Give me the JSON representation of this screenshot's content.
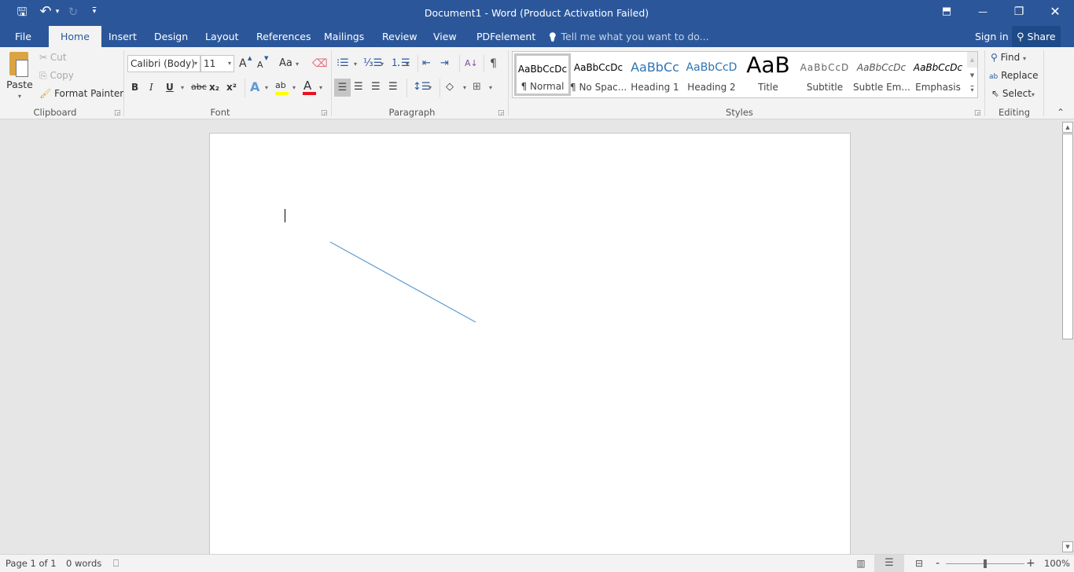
{
  "window": {
    "title": "Document1 - Word (Product Activation Failed)",
    "controls": {
      "ribbon_display": "⬒",
      "minimize": "—",
      "restore": "❐",
      "close": "✕"
    }
  },
  "quick_access": {
    "save": "🖫",
    "undo": "↶",
    "undo_dd": "▾",
    "redo": "↻",
    "customize": "▾"
  },
  "tabs": [
    {
      "label": "File"
    },
    {
      "label": "Home"
    },
    {
      "label": "Insert"
    },
    {
      "label": "Design"
    },
    {
      "label": "Layout"
    },
    {
      "label": "References"
    },
    {
      "label": "Mailings"
    },
    {
      "label": "Review"
    },
    {
      "label": "View"
    },
    {
      "label": "PDFelement"
    }
  ],
  "tell_me": {
    "icon": "💡",
    "placeholder": "Tell me what you want to do..."
  },
  "account": {
    "sign_in": "Sign in",
    "share": "Share"
  },
  "clipboard": {
    "label": "Clipboard",
    "paste": "Paste",
    "cut": "Cut",
    "copy": "Copy",
    "format_painter": "Format Painter"
  },
  "font": {
    "label": "Font",
    "family": "Calibri (Body)",
    "size": "11",
    "grow": "A",
    "shrink": "A",
    "case": "Aa",
    "bold": "B",
    "italic": "I",
    "underline": "U",
    "strike": "abc",
    "subscript": "x₂",
    "superscript": "x²",
    "effects": "A",
    "highlight": "ab",
    "color": "A",
    "highlight_color": "#ffff00",
    "font_color": "#e81123"
  },
  "paragraph": {
    "label": "Paragraph",
    "show_marks": "¶",
    "sort": "A↓"
  },
  "styles": {
    "label": "Styles",
    "items": [
      {
        "preview": "AaBbCcDc",
        "name": "¶ Normal",
        "selected": true
      },
      {
        "preview": "AaBbCcDc",
        "name": "¶ No Spac..."
      },
      {
        "preview": "AaBbCc",
        "name": "Heading 1"
      },
      {
        "preview": "AaBbCcD",
        "name": "Heading 2"
      },
      {
        "preview": "AaB",
        "name": "Title"
      },
      {
        "preview": "AaBbCcD",
        "name": "Subtitle"
      },
      {
        "preview": "AaBbCcDc",
        "name": "Subtle Em..."
      },
      {
        "preview": "AaBbCcDc",
        "name": "Emphasis"
      }
    ]
  },
  "editing": {
    "label": "Editing",
    "find": "Find",
    "replace": "Replace",
    "select": "Select"
  },
  "document": {
    "line_color": "#5b9bd5"
  },
  "status": {
    "page": "Page 1 of 1",
    "words": "0 words",
    "zoom": "100%",
    "zoom_minus": "-",
    "zoom_plus": "+",
    "zoom_level": 0.5
  }
}
